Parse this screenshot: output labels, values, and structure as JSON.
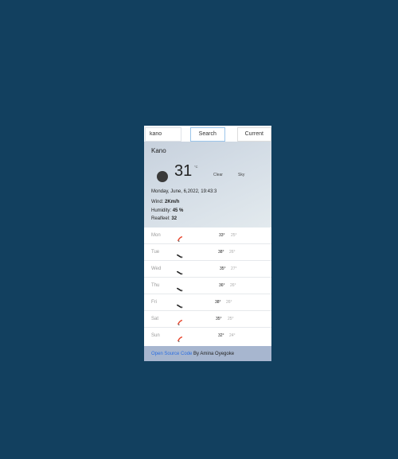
{
  "search": {
    "value": "kano",
    "search_label": "Search",
    "current_label": "Current"
  },
  "current": {
    "city": "Kano",
    "temperature": "31",
    "unit": "°C",
    "condition_left": "Clear",
    "condition_right": "Sky",
    "date": "Monday, June, 6,2022, 19:43:3",
    "wind_label": "Wind:",
    "wind_value": "2Km/h",
    "humidity_label": "Humidity:",
    "humidity_value": "45 %",
    "realfeel_label": "Realfeel:",
    "realfeel_value": "32"
  },
  "forecast": [
    {
      "day": "Mon",
      "hi": "33°",
      "lo": "25°",
      "icon": "rain-icon"
    },
    {
      "day": "Tue",
      "hi": "38°",
      "lo": "26°",
      "icon": "cloud-icon"
    },
    {
      "day": "Wed",
      "hi": "35°",
      "lo": "27°",
      "icon": "cloud-icon"
    },
    {
      "day": "Thu",
      "hi": "36°",
      "lo": "26°",
      "icon": "cloud-icon"
    },
    {
      "day": "Fri",
      "hi": "38°",
      "lo": "26°",
      "icon": "cloud-icon"
    },
    {
      "day": "Sat",
      "hi": "35°",
      "lo": "25°",
      "icon": "rain-icon"
    },
    {
      "day": "Sun",
      "hi": "32°",
      "lo": "24°",
      "icon": "rain-icon"
    }
  ],
  "footer": {
    "link_text": "Open Source Code",
    "credit": " By Amina Oyegoke"
  },
  "colors": {
    "page_bg": "#12405f",
    "footer_bg": "#a7b6cf",
    "link": "#2d6fe0",
    "rain_accent": "#e8452c"
  }
}
